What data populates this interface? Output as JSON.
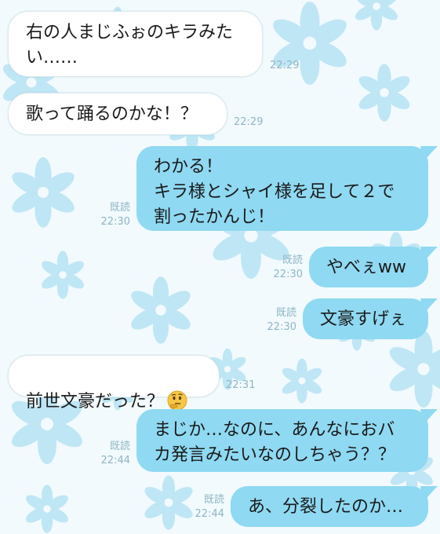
{
  "chat": {
    "messages": [
      {
        "side": "in",
        "text": "右の人まじふぉのキラみたい……",
        "time": "22:29"
      },
      {
        "side": "in",
        "text": "歌って踊るのかな！？",
        "time": "22:29"
      },
      {
        "side": "out",
        "text": "わかる！\nキラ様とシャイ様を足して２で割ったかんじ！",
        "read": "既読",
        "time": "22:30"
      },
      {
        "side": "out",
        "text": "やべぇww",
        "read": "既読",
        "time": "22:30"
      },
      {
        "side": "out",
        "text": "文豪すげぇ",
        "read": "既読",
        "time": "22:30"
      },
      {
        "side": "in",
        "text": "前世文豪だった？",
        "emoji": "thinking-face-emoji",
        "time": "22:31"
      },
      {
        "side": "out",
        "text": "まじか…なのに、あんなにおバカ発言みたいなのしちゃう？？",
        "read": "既読",
        "time": "22:44"
      },
      {
        "side": "out",
        "text": "あ、分裂したのか…",
        "read": "既読",
        "time": "22:44"
      }
    ]
  },
  "colors": {
    "outgoing_bubble": "#8fd9f2",
    "incoming_bubble": "#ffffff",
    "background": "#f2fafd",
    "background_flowers": "#bfe6f5",
    "meta_text": "#8fb6c4"
  }
}
